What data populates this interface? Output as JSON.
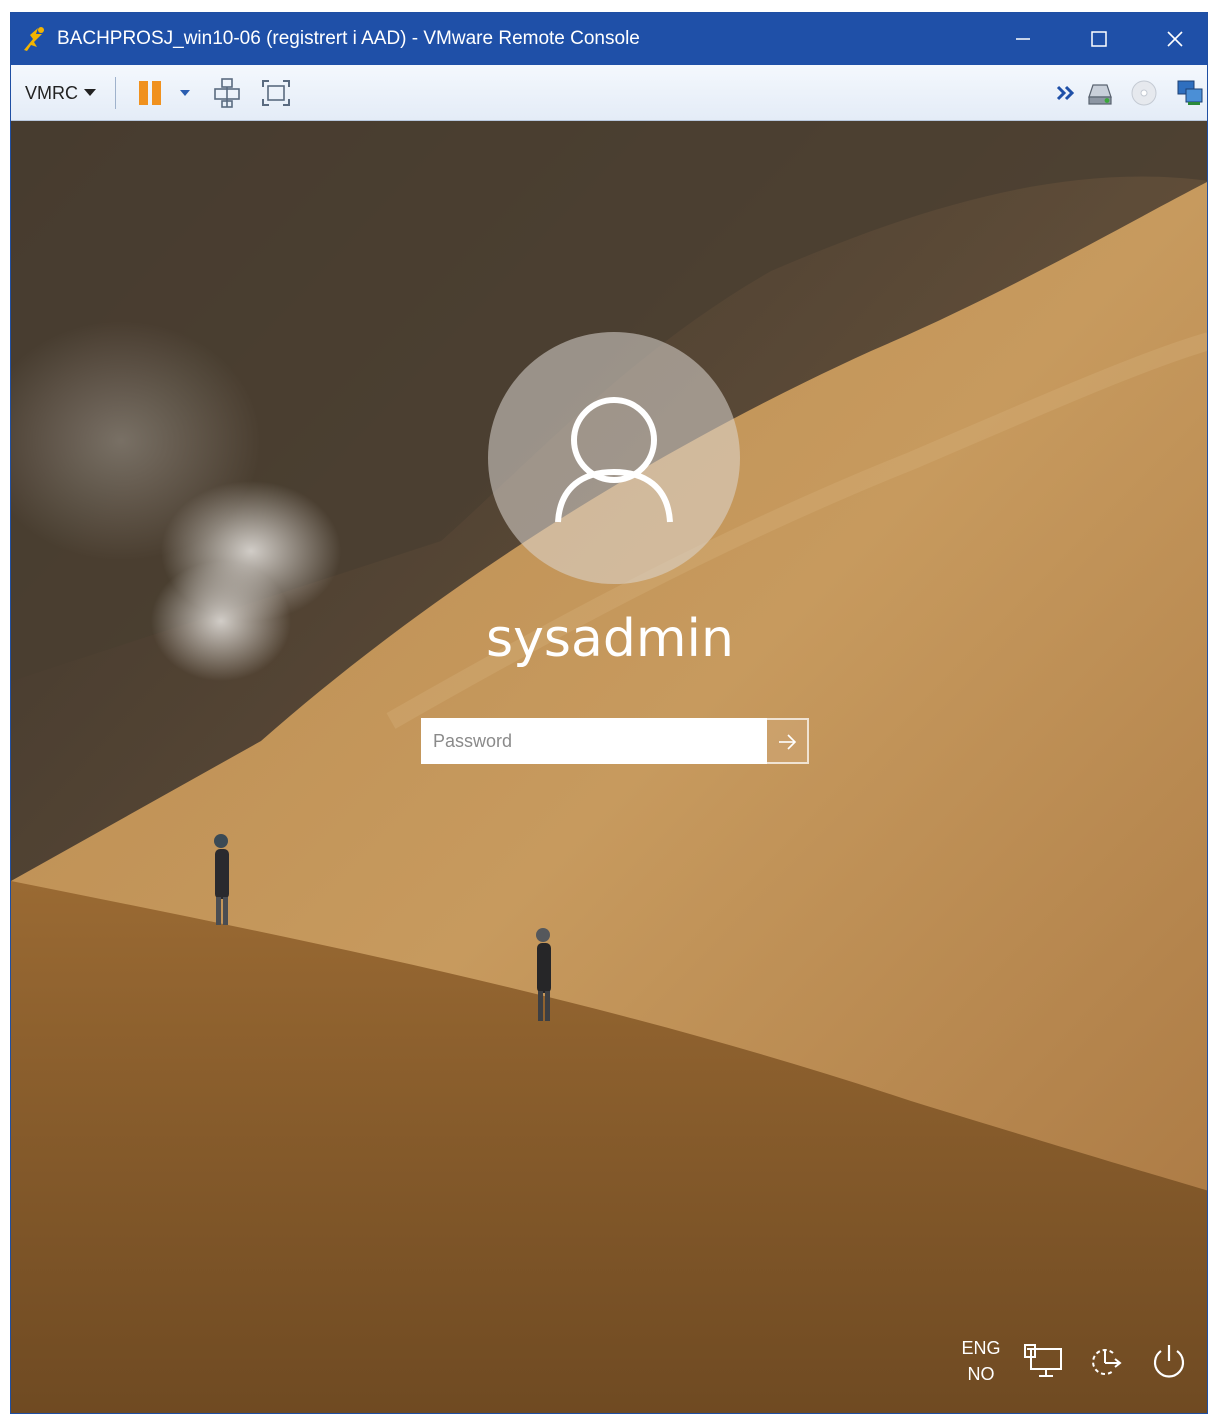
{
  "window": {
    "title": "BACHPROSJ_win10-06 (registrert i AAD) - VMware Remote Console",
    "controls": [
      "minimize-icon",
      "maximize-icon",
      "close-icon"
    ],
    "accent_color": "#1f50a8"
  },
  "toolbar": {
    "menu_label": "VMRC",
    "items": [
      "pause-icon",
      "dropdown-caret-icon",
      "ctrl-alt-del-icon",
      "fullscreen-icon",
      "double-chevron-icon",
      "hard-disk-icon",
      "cd-rom-icon",
      "network-adapter-icon"
    ]
  },
  "lockscreen": {
    "username": "sysadmin",
    "password": {
      "placeholder": "Password",
      "value": ""
    },
    "language": {
      "top": "ENG",
      "bottom": "NO"
    },
    "icons": [
      "user-avatar-icon",
      "submit-arrow-icon",
      "network-icon",
      "ease-of-access-icon",
      "power-icon"
    ]
  }
}
